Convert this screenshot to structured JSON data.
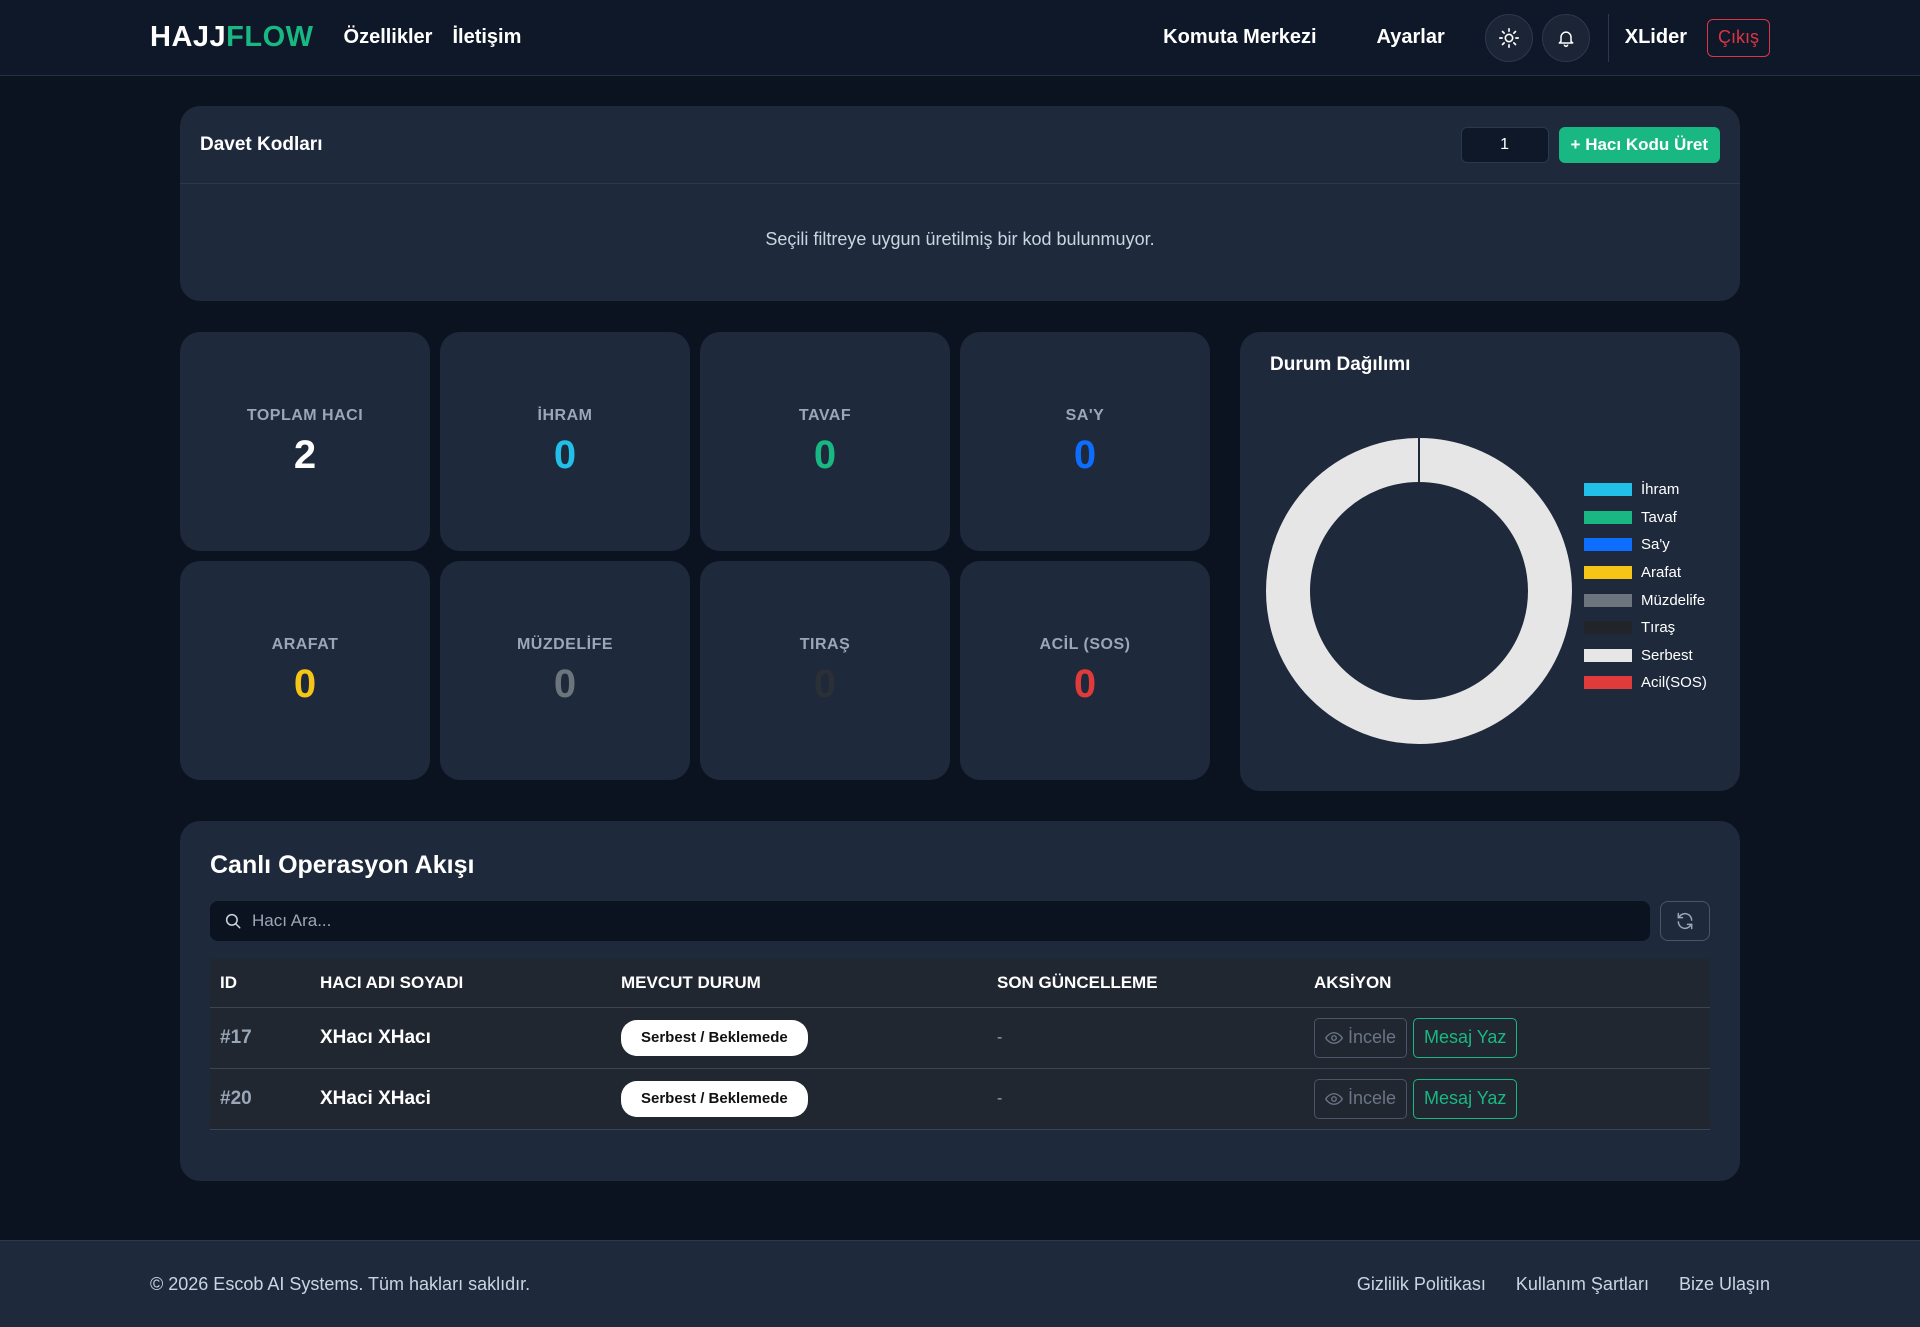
{
  "navbar": {
    "brand_part1": "HAJJ",
    "brand_part2": "FLOW",
    "links": [
      "Özellikler",
      "İletişim"
    ],
    "command_center": "Komuta Merkezi",
    "settings": "Ayarlar",
    "theme_icon": "sun-icon",
    "notify_icon": "bell-icon",
    "username": "XLider",
    "logout": "Çıkış"
  },
  "invite": {
    "title": "Davet Kodları",
    "quantity": "1",
    "generate_label": "+ Hacı Kodu Üret",
    "empty_message": "Seçili filtreye uygun üretilmiş bir kod bulunmuyor."
  },
  "stats": [
    {
      "label": "TOPLAM HACI",
      "value": "2",
      "color": "#ffffff"
    },
    {
      "label": "İHRAM",
      "value": "0",
      "color": "#22c0e8"
    },
    {
      "label": "TAVAF",
      "value": "0",
      "color": "#19b882"
    },
    {
      "label": "SA'Y",
      "value": "0",
      "color": "#0d6efd"
    },
    {
      "label": "ARAFAT",
      "value": "0",
      "color": "#f5c518"
    },
    {
      "label": "MÜZDELİFE",
      "value": "0",
      "color": "#6c757d"
    },
    {
      "label": "TIRAŞ",
      "value": "0",
      "color": "#2b2f36"
    },
    {
      "label": "ACİL (SOS)",
      "value": "0",
      "color": "#e03b3b"
    }
  ],
  "chart_data": {
    "type": "pie",
    "title": "Durum Dağılımı",
    "categories": [
      "İhram",
      "Tavaf",
      "Sa'y",
      "Arafat",
      "Müzdelife",
      "Tıraş",
      "Serbest",
      "Acil(SOS)"
    ],
    "values": [
      0,
      0,
      0,
      0,
      0,
      0,
      2,
      0
    ],
    "colors": [
      "#22c0e8",
      "#19b882",
      "#0d6efd",
      "#f5c518",
      "#6c757d",
      "#212529",
      "#e6e6e6",
      "#e03b3b"
    ],
    "legend": "right"
  },
  "ops": {
    "title": "Canlı Operasyon Akışı",
    "search_placeholder": "Hacı Ara...",
    "columns": [
      "ID",
      "HACI ADI SOYADI",
      "MEVCUT DURUM",
      "SON GÜNCELLEME",
      "AKSİYON"
    ],
    "rows": [
      {
        "id": "#17",
        "name": "XHacı XHacı",
        "status": "Serbest / Beklemede",
        "updated": "-",
        "view": "İncele",
        "message": "Mesaj Yaz"
      },
      {
        "id": "#20",
        "name": "XHaci XHaci",
        "status": "Serbest / Beklemede",
        "updated": "-",
        "view": "İncele",
        "message": "Mesaj Yaz"
      }
    ]
  },
  "footer": {
    "copyright": "© 2026 Escob AI Systems. Tüm hakları saklıdır.",
    "links": [
      "Gizlilik Politikası",
      "Kullanım Şartları",
      "Bize Ulaşın"
    ]
  }
}
